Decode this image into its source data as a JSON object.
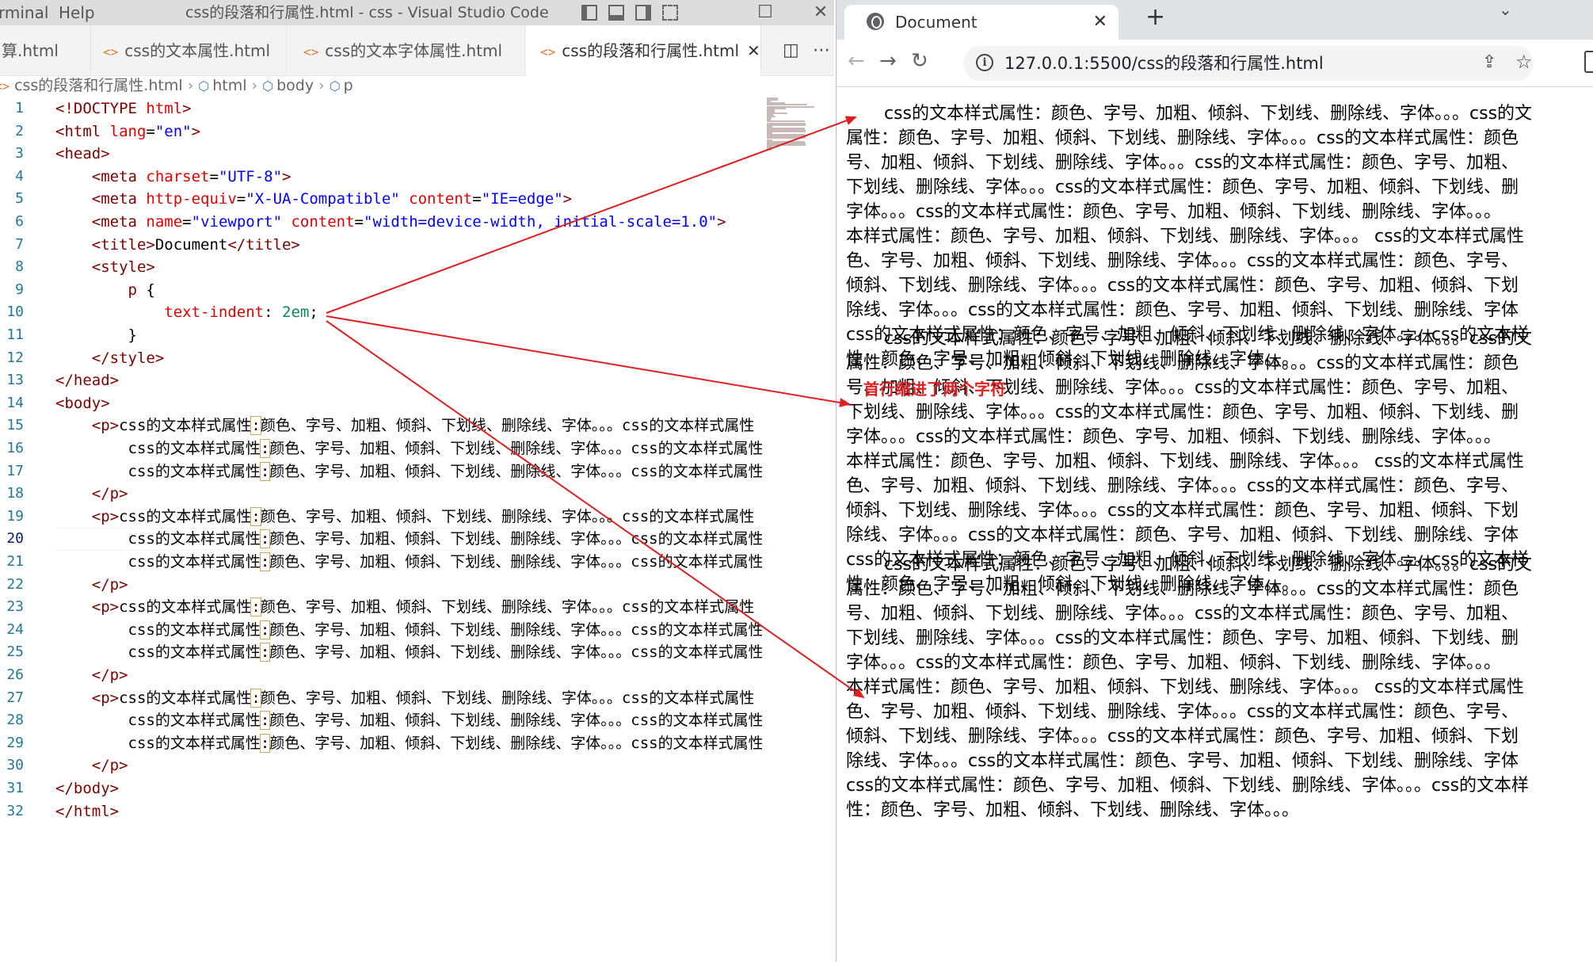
{
  "vscode": {
    "menu": [
      "rminal",
      "Help"
    ],
    "window_title": "css的段落和行属性.html - css - Visual Studio Code",
    "tabs": [
      {
        "label": "算.html",
        "active": false
      },
      {
        "label": "css的文本属性.html",
        "active": false
      },
      {
        "label": "css的文本字体属性.html",
        "active": false
      },
      {
        "label": "css的段落和行属性.html",
        "active": true
      }
    ],
    "breadcrumb": [
      "css的段落和行属性.html",
      "html",
      "body",
      "p"
    ],
    "current_line": 20,
    "colors": {
      "tag": "#800000",
      "attr": "#e50000",
      "value": "#0000ff",
      "number": "#098658",
      "line_number": "#237893"
    }
  },
  "code_lines": [
    [
      [
        "t-tag",
        "<!DOCTYPE "
      ],
      [
        "t-attr",
        "html"
      ],
      [
        "t-tag",
        ">"
      ]
    ],
    [
      [
        "t-tag",
        "<html "
      ],
      [
        "t-attr",
        "lang"
      ],
      [
        "t-txt",
        "="
      ],
      [
        "t-val",
        "\"en\""
      ],
      [
        "t-tag",
        ">"
      ]
    ],
    [
      [
        "t-tag",
        "<head>"
      ]
    ],
    [
      [
        "t-txt",
        "    "
      ],
      [
        "t-tag",
        "<meta "
      ],
      [
        "t-attr",
        "charset"
      ],
      [
        "t-txt",
        "="
      ],
      [
        "t-val",
        "\"UTF-8\""
      ],
      [
        "t-tag",
        ">"
      ]
    ],
    [
      [
        "t-txt",
        "    "
      ],
      [
        "t-tag",
        "<meta "
      ],
      [
        "t-attr",
        "http-equiv"
      ],
      [
        "t-txt",
        "="
      ],
      [
        "t-val",
        "\"X-UA-Compatible\""
      ],
      [
        "t-txt",
        " "
      ],
      [
        "t-attr",
        "content"
      ],
      [
        "t-txt",
        "="
      ],
      [
        "t-val",
        "\"IE=edge\""
      ],
      [
        "t-tag",
        ">"
      ]
    ],
    [
      [
        "t-txt",
        "    "
      ],
      [
        "t-tag",
        "<meta "
      ],
      [
        "t-attr",
        "name"
      ],
      [
        "t-txt",
        "="
      ],
      [
        "t-val",
        "\"viewport\""
      ],
      [
        "t-txt",
        " "
      ],
      [
        "t-attr",
        "content"
      ],
      [
        "t-txt",
        "="
      ],
      [
        "t-val",
        "\"width=device-width, initial-scale=1.0\""
      ],
      [
        "t-tag",
        ">"
      ]
    ],
    [
      [
        "t-txt",
        "    "
      ],
      [
        "t-tag",
        "<title>"
      ],
      [
        "t-txt",
        "Document"
      ],
      [
        "t-tag",
        "</title>"
      ]
    ],
    [
      [
        "t-txt",
        "    "
      ],
      [
        "t-tag",
        "<style>"
      ]
    ],
    [
      [
        "t-txt",
        "        "
      ],
      [
        "t-sel",
        "p"
      ],
      [
        "t-txt",
        " {"
      ]
    ],
    [
      [
        "t-txt",
        "            "
      ],
      [
        "t-prop",
        "text-indent"
      ],
      [
        "t-txt",
        ": "
      ],
      [
        "t-num",
        "2em"
      ],
      [
        "t-txt",
        ";"
      ]
    ],
    [
      [
        "t-txt",
        "        }"
      ]
    ],
    [
      [
        "t-txt",
        "    "
      ],
      [
        "t-tag",
        "</style>"
      ]
    ],
    [
      [
        "t-tag",
        "</head>"
      ]
    ],
    [
      [
        "t-tag",
        "<body>"
      ]
    ],
    [
      [
        "t-txt",
        "    "
      ],
      [
        "t-tag",
        "<p>"
      ],
      [
        "t-txt",
        "css的文本样式属性"
      ],
      [
        "colon",
        ":"
      ],
      [
        "t-txt",
        "颜色、字号、加粗、倾斜、下划线、删除线、字体。。。css的文本样式属性"
      ]
    ],
    [
      [
        "t-txt",
        "        css的文本样式属性"
      ],
      [
        "colon",
        ":"
      ],
      [
        "t-txt",
        "颜色、字号、加粗、倾斜、下划线、删除线、字体。。。css的文本样式属性"
      ]
    ],
    [
      [
        "t-txt",
        "        css的文本样式属性"
      ],
      [
        "colon",
        ":"
      ],
      [
        "t-txt",
        "颜色、字号、加粗、倾斜、下划线、删除线、字体。。。css的文本样式属性"
      ]
    ],
    [
      [
        "t-txt",
        "    "
      ],
      [
        "t-tag",
        "</p>"
      ]
    ],
    [
      [
        "t-txt",
        "    "
      ],
      [
        "t-tag",
        "<p>"
      ],
      [
        "t-txt",
        "css的文本样式属性"
      ],
      [
        "colon",
        ":"
      ],
      [
        "t-txt",
        "颜色、字号、加粗、倾斜、下划线、删除线、字体。。。css的文本样式属性"
      ]
    ],
    [
      [
        "t-txt",
        "        css的文本样式属性"
      ],
      [
        "colon",
        ":"
      ],
      [
        "t-txt",
        "颜色、字号、加粗、倾斜、下划线、删除线、字体。。。css的文本样式属性"
      ]
    ],
    [
      [
        "t-txt",
        "        css的文本样式属性"
      ],
      [
        "colon",
        ":"
      ],
      [
        "t-txt",
        "颜色、字号、加粗、倾斜、下划线、删除线、字体。。。css的文本样式属性"
      ]
    ],
    [
      [
        "t-txt",
        "    "
      ],
      [
        "t-tag",
        "</p>"
      ]
    ],
    [
      [
        "t-txt",
        "    "
      ],
      [
        "t-tag",
        "<p>"
      ],
      [
        "t-txt",
        "css的文本样式属性"
      ],
      [
        "colon",
        ":"
      ],
      [
        "t-txt",
        "颜色、字号、加粗、倾斜、下划线、删除线、字体。。。css的文本样式属性"
      ]
    ],
    [
      [
        "t-txt",
        "        css的文本样式属性"
      ],
      [
        "colon",
        ":"
      ],
      [
        "t-txt",
        "颜色、字号、加粗、倾斜、下划线、删除线、字体。。。css的文本样式属性"
      ]
    ],
    [
      [
        "t-txt",
        "        css的文本样式属性"
      ],
      [
        "colon",
        ":"
      ],
      [
        "t-txt",
        "颜色、字号、加粗、倾斜、下划线、删除线、字体。。。css的文本样式属性"
      ]
    ],
    [
      [
        "t-txt",
        "    "
      ],
      [
        "t-tag",
        "</p>"
      ]
    ],
    [
      [
        "t-txt",
        "    "
      ],
      [
        "t-tag",
        "<p>"
      ],
      [
        "t-txt",
        "css的文本样式属性"
      ],
      [
        "colon",
        ":"
      ],
      [
        "t-txt",
        "颜色、字号、加粗、倾斜、下划线、删除线、字体。。。css的文本样式属性"
      ]
    ],
    [
      [
        "t-txt",
        "        css的文本样式属性"
      ],
      [
        "colon",
        ":"
      ],
      [
        "t-txt",
        "颜色、字号、加粗、倾斜、下划线、删除线、字体。。。css的文本样式属性"
      ]
    ],
    [
      [
        "t-txt",
        "        css的文本样式属性"
      ],
      [
        "colon",
        ":"
      ],
      [
        "t-txt",
        "颜色、字号、加粗、倾斜、下划线、删除线、字体。。。css的文本样式属性"
      ]
    ],
    [
      [
        "t-txt",
        "    "
      ],
      [
        "t-tag",
        "</p>"
      ]
    ],
    [
      [
        "t-tag",
        "</body>"
      ]
    ],
    [
      [
        "t-tag",
        "</html>"
      ]
    ]
  ],
  "browser": {
    "tab_title": "Document",
    "url": "127.0.0.1:5500/css的段落和行属性.html",
    "paragraphs": [
      [
        "css的文本样式属性：颜色、字号、加粗、倾斜、下划线、删除线、字体。。。css的文",
        "属性：颜色、字号、加粗、倾斜、下划线、删除线、字体。。。css的文本样式属性：颜色",
        "号、加粗、倾斜、下划线、删除线、字体。。。css的文本样式属性：颜色、字号、加粗、",
        "下划线、删除线、字体。。。css的文本样式属性：颜色、字号、加粗、倾斜、下划线、删",
        "字体。。。css的文本样式属性：颜色、字号、加粗、倾斜、下划线、删除线、字体。。。",
        "本样式属性：颜色、字号、加粗、倾斜、下划线、删除线、字体。。。 css的文本样式属性",
        "色、字号、加粗、倾斜、下划线、删除线、字体。。。css的文本样式属性：颜色、字号、",
        "倾斜、下划线、删除线、字体。。。css的文本样式属性：颜色、字号、加粗、倾斜、下划",
        "除线、字体。。。css的文本样式属性：颜色、字号、加粗、倾斜、下划线、删除线、字体",
        "css的文本样式属性：颜色、字号、加粗、倾斜、下划线、删除线、字体。。。css的文本样",
        "性：颜色、字号、加粗、倾斜、下划线、删除线、字体。。。"
      ],
      [
        "css的文本样式属性：颜色、字号、加粗、倾斜、下划线、删除线、字体。。。css的文",
        "属性：颜色、字号、加粗、倾斜、下划线、删除线、字体。。。css的文本样式属性：颜色",
        "号、加粗、倾斜、下划线、删除线、字体。。。css的文本样式属性：颜色、字号、加粗、",
        "下划线、删除线、字体。。。css的文本样式属性：颜色、字号、加粗、倾斜、下划线、删",
        "字体。。。css的文本样式属性：颜色、字号、加粗、倾斜、下划线、删除线、字体。。。",
        "本样式属性：颜色、字号、加粗、倾斜、下划线、删除线、字体。。。 css的文本样式属性",
        "色、字号、加粗、倾斜、下划线、删除线、字体。。。css的文本样式属性：颜色、字号、",
        "倾斜、下划线、删除线、字体。。。css的文本样式属性：颜色、字号、加粗、倾斜、下划",
        "除线、字体。。。css的文本样式属性：颜色、字号、加粗、倾斜、下划线、删除线、字体",
        "css的文本样式属性：颜色、字号、加粗、倾斜、下划线、删除线、字体。。。css的文本样",
        "性：颜色、字号、加粗、倾斜、下划线、删除线、字体。。。"
      ],
      [
        "css的文本样式属性：颜色、字号、加粗、倾斜、下划线、删除线、字体。。。css的文",
        "属性：颜色、字号、加粗、倾斜、下划线、删除线、字体。。。css的文本样式属性：颜色",
        "号、加粗、倾斜、下划线、删除线、字体。。。css的文本样式属性：颜色、字号、加粗、",
        "下划线、删除线、字体。。。css的文本样式属性：颜色、字号、加粗、倾斜、下划线、删",
        "字体。。。css的文本样式属性：颜色、字号、加粗、倾斜、下划线、删除线、字体。。。",
        "本样式属性：颜色、字号、加粗、倾斜、下划线、删除线、字体。。。 css的文本样式属性",
        "色、字号、加粗、倾斜、下划线、删除线、字体。。。css的文本样式属性：颜色、字号、",
        "倾斜、下划线、删除线、字体。。。css的文本样式属性：颜色、字号、加粗、倾斜、下划",
        "除线、字体。。。css的文本样式属性：颜色、字号、加粗、倾斜、下划线、删除线、字体",
        "css的文本样式属性：颜色、字号、加粗、倾斜、下划线、删除线、字体。。。css的文本样",
        "性：颜色、字号、加粗、倾斜、下划线、删除线、字体。。。"
      ]
    ]
  },
  "annotation": {
    "text": "首行缩进了两个字符",
    "color": "#e02020"
  }
}
